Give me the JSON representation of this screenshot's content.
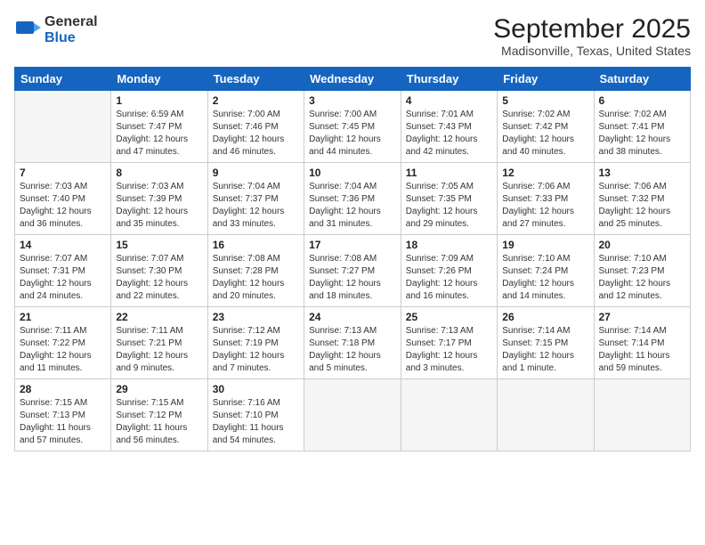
{
  "header": {
    "logo_line1": "General",
    "logo_line2": "Blue",
    "month": "September 2025",
    "location": "Madisonville, Texas, United States"
  },
  "days_of_week": [
    "Sunday",
    "Monday",
    "Tuesday",
    "Wednesday",
    "Thursday",
    "Friday",
    "Saturday"
  ],
  "weeks": [
    [
      {
        "day": "",
        "info": ""
      },
      {
        "day": "1",
        "info": "Sunrise: 6:59 AM\nSunset: 7:47 PM\nDaylight: 12 hours\nand 47 minutes."
      },
      {
        "day": "2",
        "info": "Sunrise: 7:00 AM\nSunset: 7:46 PM\nDaylight: 12 hours\nand 46 minutes."
      },
      {
        "day": "3",
        "info": "Sunrise: 7:00 AM\nSunset: 7:45 PM\nDaylight: 12 hours\nand 44 minutes."
      },
      {
        "day": "4",
        "info": "Sunrise: 7:01 AM\nSunset: 7:43 PM\nDaylight: 12 hours\nand 42 minutes."
      },
      {
        "day": "5",
        "info": "Sunrise: 7:02 AM\nSunset: 7:42 PM\nDaylight: 12 hours\nand 40 minutes."
      },
      {
        "day": "6",
        "info": "Sunrise: 7:02 AM\nSunset: 7:41 PM\nDaylight: 12 hours\nand 38 minutes."
      }
    ],
    [
      {
        "day": "7",
        "info": "Sunrise: 7:03 AM\nSunset: 7:40 PM\nDaylight: 12 hours\nand 36 minutes."
      },
      {
        "day": "8",
        "info": "Sunrise: 7:03 AM\nSunset: 7:39 PM\nDaylight: 12 hours\nand 35 minutes."
      },
      {
        "day": "9",
        "info": "Sunrise: 7:04 AM\nSunset: 7:37 PM\nDaylight: 12 hours\nand 33 minutes."
      },
      {
        "day": "10",
        "info": "Sunrise: 7:04 AM\nSunset: 7:36 PM\nDaylight: 12 hours\nand 31 minutes."
      },
      {
        "day": "11",
        "info": "Sunrise: 7:05 AM\nSunset: 7:35 PM\nDaylight: 12 hours\nand 29 minutes."
      },
      {
        "day": "12",
        "info": "Sunrise: 7:06 AM\nSunset: 7:33 PM\nDaylight: 12 hours\nand 27 minutes."
      },
      {
        "day": "13",
        "info": "Sunrise: 7:06 AM\nSunset: 7:32 PM\nDaylight: 12 hours\nand 25 minutes."
      }
    ],
    [
      {
        "day": "14",
        "info": "Sunrise: 7:07 AM\nSunset: 7:31 PM\nDaylight: 12 hours\nand 24 minutes."
      },
      {
        "day": "15",
        "info": "Sunrise: 7:07 AM\nSunset: 7:30 PM\nDaylight: 12 hours\nand 22 minutes."
      },
      {
        "day": "16",
        "info": "Sunrise: 7:08 AM\nSunset: 7:28 PM\nDaylight: 12 hours\nand 20 minutes."
      },
      {
        "day": "17",
        "info": "Sunrise: 7:08 AM\nSunset: 7:27 PM\nDaylight: 12 hours\nand 18 minutes."
      },
      {
        "day": "18",
        "info": "Sunrise: 7:09 AM\nSunset: 7:26 PM\nDaylight: 12 hours\nand 16 minutes."
      },
      {
        "day": "19",
        "info": "Sunrise: 7:10 AM\nSunset: 7:24 PM\nDaylight: 12 hours\nand 14 minutes."
      },
      {
        "day": "20",
        "info": "Sunrise: 7:10 AM\nSunset: 7:23 PM\nDaylight: 12 hours\nand 12 minutes."
      }
    ],
    [
      {
        "day": "21",
        "info": "Sunrise: 7:11 AM\nSunset: 7:22 PM\nDaylight: 12 hours\nand 11 minutes."
      },
      {
        "day": "22",
        "info": "Sunrise: 7:11 AM\nSunset: 7:21 PM\nDaylight: 12 hours\nand 9 minutes."
      },
      {
        "day": "23",
        "info": "Sunrise: 7:12 AM\nSunset: 7:19 PM\nDaylight: 12 hours\nand 7 minutes."
      },
      {
        "day": "24",
        "info": "Sunrise: 7:13 AM\nSunset: 7:18 PM\nDaylight: 12 hours\nand 5 minutes."
      },
      {
        "day": "25",
        "info": "Sunrise: 7:13 AM\nSunset: 7:17 PM\nDaylight: 12 hours\nand 3 minutes."
      },
      {
        "day": "26",
        "info": "Sunrise: 7:14 AM\nSunset: 7:15 PM\nDaylight: 12 hours\nand 1 minute."
      },
      {
        "day": "27",
        "info": "Sunrise: 7:14 AM\nSunset: 7:14 PM\nDaylight: 11 hours\nand 59 minutes."
      }
    ],
    [
      {
        "day": "28",
        "info": "Sunrise: 7:15 AM\nSunset: 7:13 PM\nDaylight: 11 hours\nand 57 minutes."
      },
      {
        "day": "29",
        "info": "Sunrise: 7:15 AM\nSunset: 7:12 PM\nDaylight: 11 hours\nand 56 minutes."
      },
      {
        "day": "30",
        "info": "Sunrise: 7:16 AM\nSunset: 7:10 PM\nDaylight: 11 hours\nand 54 minutes."
      },
      {
        "day": "",
        "info": ""
      },
      {
        "day": "",
        "info": ""
      },
      {
        "day": "",
        "info": ""
      },
      {
        "day": "",
        "info": ""
      }
    ]
  ]
}
